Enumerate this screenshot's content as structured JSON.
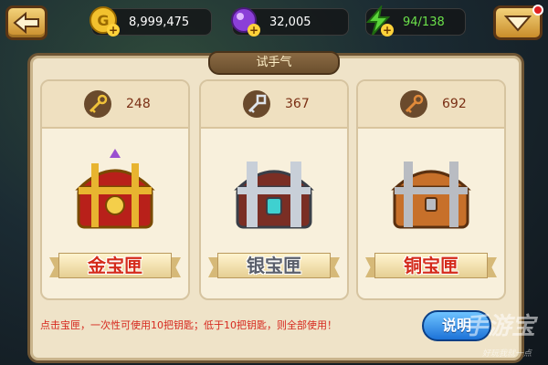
{
  "topbar": {
    "gold": "8,999,475",
    "gems": "32,005",
    "energy": "94/138",
    "plus_label": "+"
  },
  "panel": {
    "title": "试手气",
    "cards": [
      {
        "key_count": "248",
        "label": "金宝匣",
        "chest_color": "#d4a52a"
      },
      {
        "key_count": "367",
        "label": "银宝匣",
        "chest_color": "#9aa3ad"
      },
      {
        "key_count": "692",
        "label": "铜宝匣",
        "chest_color": "#c9752e"
      }
    ],
    "hint": "点击宝匣，一次性可使用10把钥匙；低于10把钥匙，则全部使用！",
    "help_button": "说明"
  },
  "watermark": {
    "text": "手游宝",
    "tag": "好玩我就一点"
  },
  "colors": {
    "accent": "#d42a1a",
    "help_blue": "#1d73d8"
  }
}
